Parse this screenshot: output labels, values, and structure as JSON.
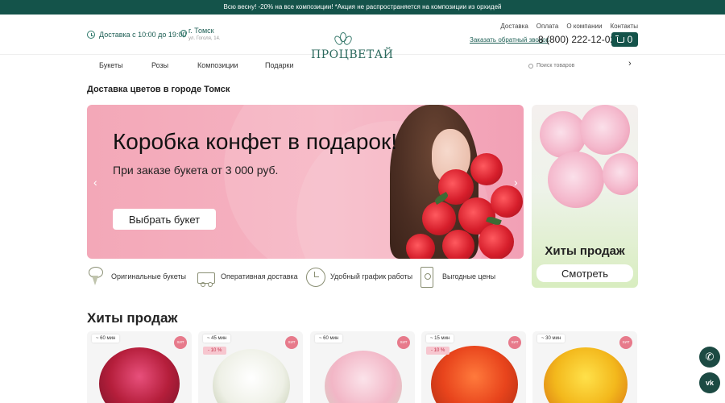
{
  "promo": {
    "text": "Всю весну! -20% на все композиции! *Акция не распространяется на композиции из орхидей"
  },
  "header": {
    "hours": "Доставка с 10:00 до 19:00",
    "city": "г. Томск",
    "address": "ул. Гоголя, 14.",
    "logo_text": "ПРОЦВЕТАЙ",
    "links": [
      "Доставка",
      "Оплата",
      "О компании",
      "Контакты"
    ],
    "callback": "Заказать обратный звонок",
    "phone": "8 (800) 222-12-02",
    "cart_count": "0"
  },
  "nav": {
    "items": [
      "Букеты",
      "Розы",
      "Композиции",
      "Подарки"
    ],
    "search_placeholder": "Поиск товаров",
    "arrow": "›"
  },
  "page_title": "Доставка цветов в городе Томск",
  "banner": {
    "title": "Коробка конфет в подарок!",
    "subtitle": "При заказе букета от 3 000 руб.",
    "button": "Выбрать букет",
    "prev": "‹",
    "next": "›"
  },
  "side_banner": {
    "title": "Хиты продаж",
    "button": "Смотреть"
  },
  "features": [
    "Оригинальные букеты",
    "Оперативная доставка",
    "Удобный график работы",
    "Выгодные цены"
  ],
  "section_title": "Хиты продаж",
  "products": [
    {
      "time": "~ 60 мин",
      "discount": "",
      "hit": "ХИТ"
    },
    {
      "time": "~ 45 мин",
      "discount": "- 10 %",
      "hit": "ХИТ"
    },
    {
      "time": "~ 60 мин",
      "discount": "",
      "hit": "ХИТ"
    },
    {
      "time": "~ 15 мин",
      "discount": "- 10 %",
      "hit": "ХИТ"
    },
    {
      "time": "~ 30 мин",
      "discount": "",
      "hit": "ХИТ"
    }
  ],
  "fab": {
    "phone": "✆",
    "vk": "vk"
  },
  "colors": {
    "brand_green": "#14534a",
    "banner_pink": "#f4a9b9",
    "hit_badge": "#e77a8b",
    "discount_bg": "#f7c6cf"
  }
}
